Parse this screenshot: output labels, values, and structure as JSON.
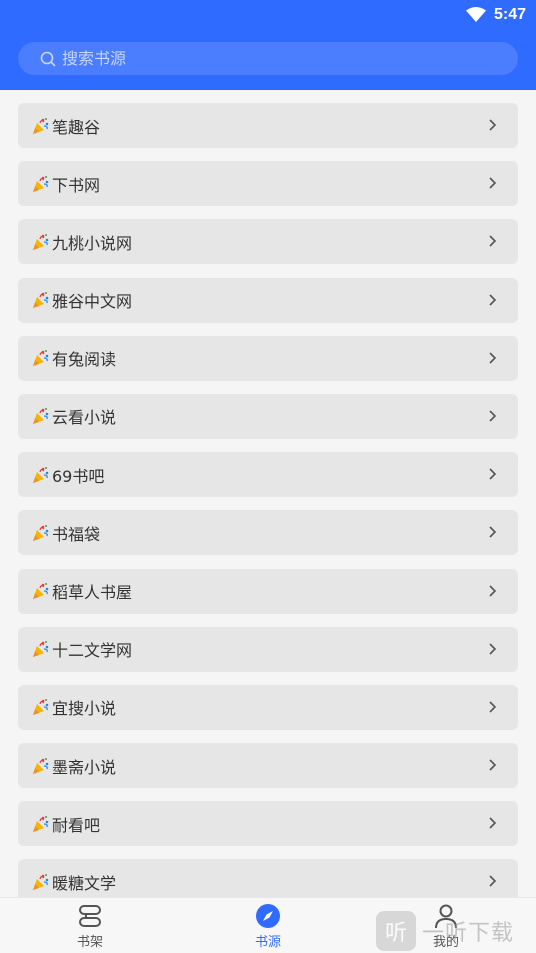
{
  "status_bar": {
    "time": "5:47"
  },
  "search": {
    "placeholder": "搜索书源",
    "value": ""
  },
  "sources": [
    {
      "label": "笔趣谷"
    },
    {
      "label": "下书网"
    },
    {
      "label": "九桃小说网"
    },
    {
      "label": "雅谷中文网"
    },
    {
      "label": "有兔阅读"
    },
    {
      "label": "云看小说"
    },
    {
      "label": "69书吧"
    },
    {
      "label": "书福袋"
    },
    {
      "label": "稻草人书屋"
    },
    {
      "label": "十二文学网"
    },
    {
      "label": "宜搜小说"
    },
    {
      "label": "墨斋小说"
    },
    {
      "label": "耐看吧"
    },
    {
      "label": "暖糖文学"
    }
  ],
  "bottom_nav": {
    "bookshelf": "书架",
    "sources": "书源",
    "mine": "我的"
  },
  "watermark": {
    "logo_char": "听",
    "text": "一听下载"
  },
  "colors": {
    "primary": "#2f6bff",
    "item_bg": "#e6e6e6"
  },
  "icons": {
    "item": "party-popper-icon"
  }
}
